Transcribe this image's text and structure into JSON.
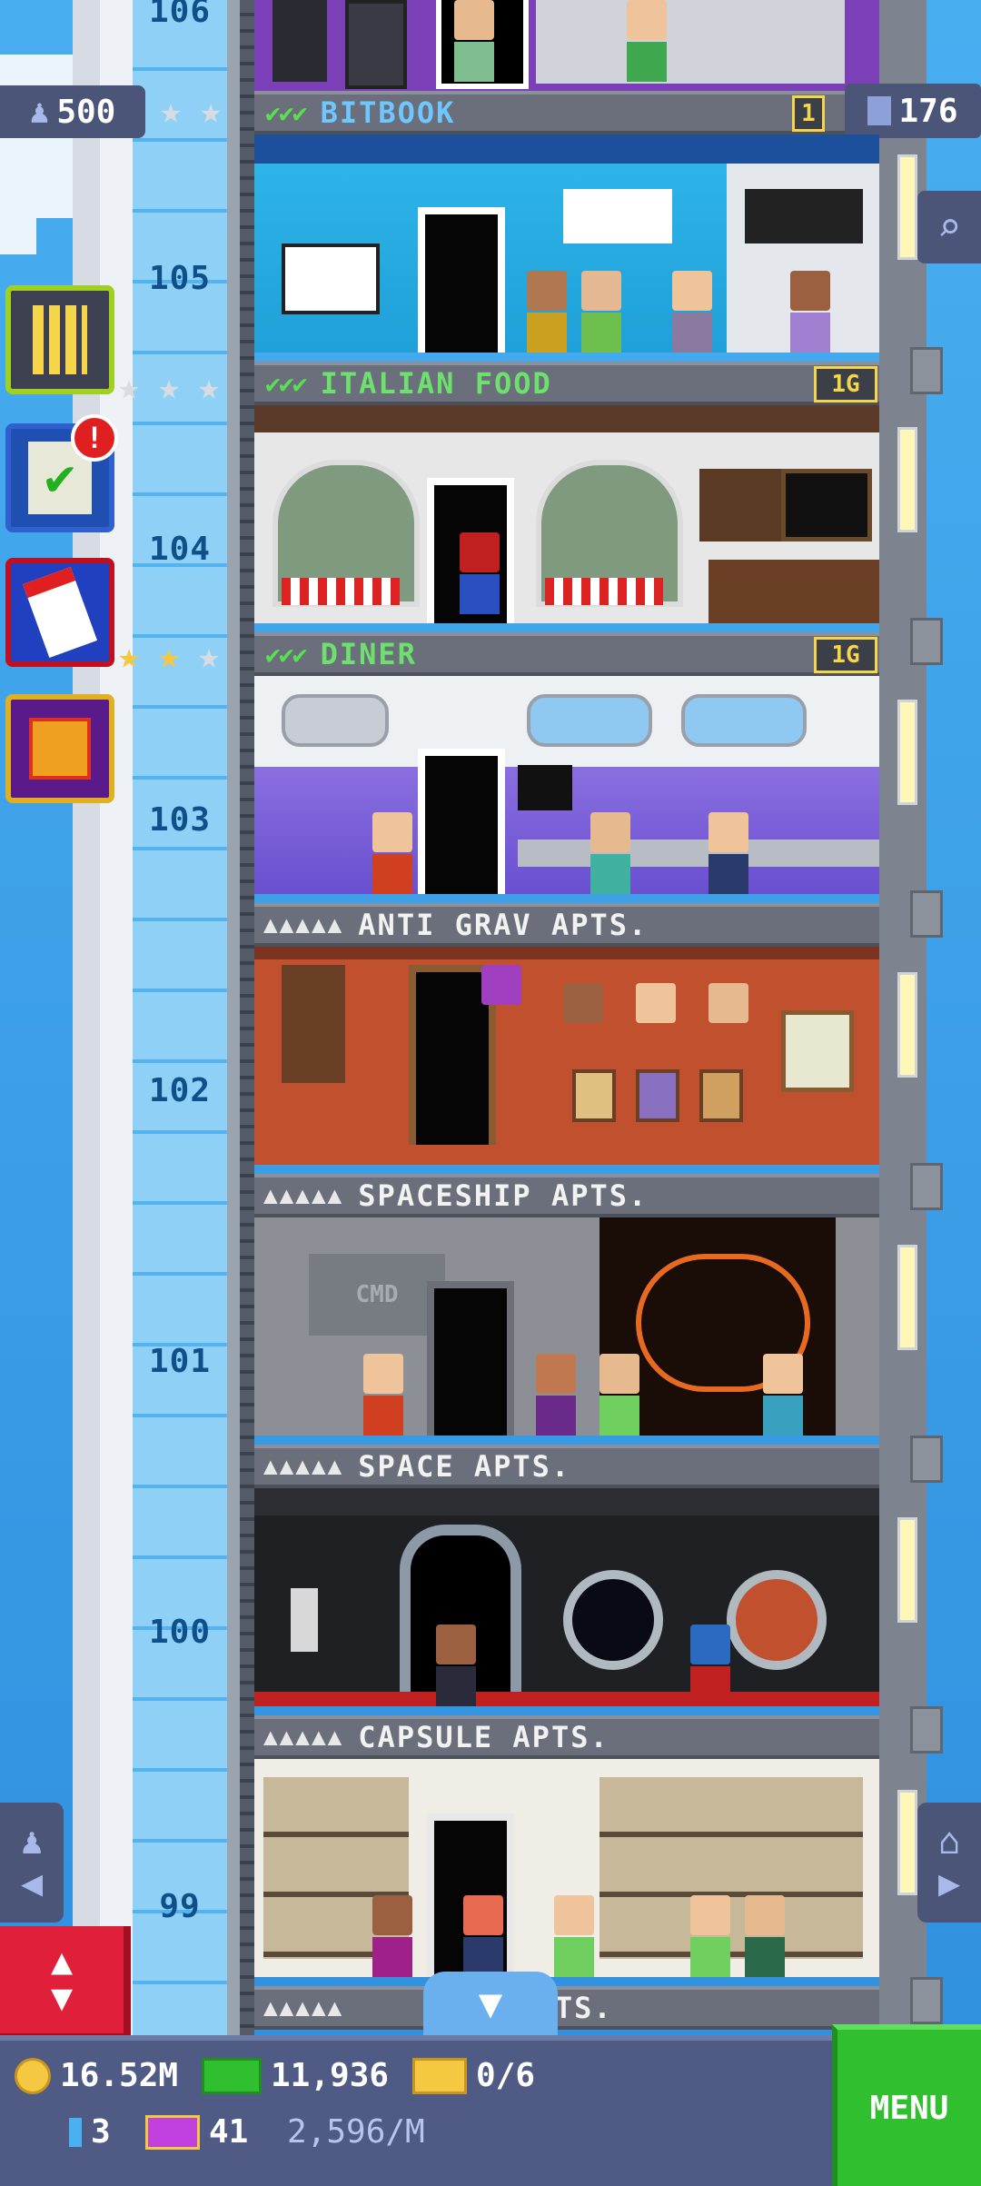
{
  "top_bar": {
    "population": "500",
    "search_icon": "magnifier-icon"
  },
  "floors": {
    "f106": "106",
    "f105": "105",
    "f104": "104",
    "f103": "103",
    "f102": "102",
    "f101": "101",
    "f100": "100",
    "f99": "99"
  },
  "banners": {
    "bitbook": {
      "name": "BITBOOK",
      "tag": "1",
      "count": "176"
    },
    "italian": {
      "name": "ITALIAN FOOD",
      "tag": "1G"
    },
    "diner": {
      "name": "DINER",
      "tag": "1G"
    },
    "anti_grav": {
      "name": "ANTI GRAV APTS."
    },
    "spaceship": {
      "name": "SPACESHIP APTS."
    },
    "space": {
      "name": "SPACE APTS."
    },
    "capsule": {
      "name": "CAPSULE APTS."
    },
    "bottom": {
      "name": "APTS."
    }
  },
  "room_text": {
    "cmd": "CMD"
  },
  "status_bar": {
    "coins": "16.52M",
    "bux": "11,936",
    "tickets": "0/6",
    "keys": "3",
    "vip": "41",
    "rate": "2,596/M",
    "menu": "MENU"
  },
  "colors": {
    "sky": "#3a9de0",
    "banner": "#6a6f7b",
    "check_green": "#58e050",
    "tag_yellow": "#f5d64a",
    "menu_green": "#2fbf2f",
    "bar": "#4f5b84"
  }
}
